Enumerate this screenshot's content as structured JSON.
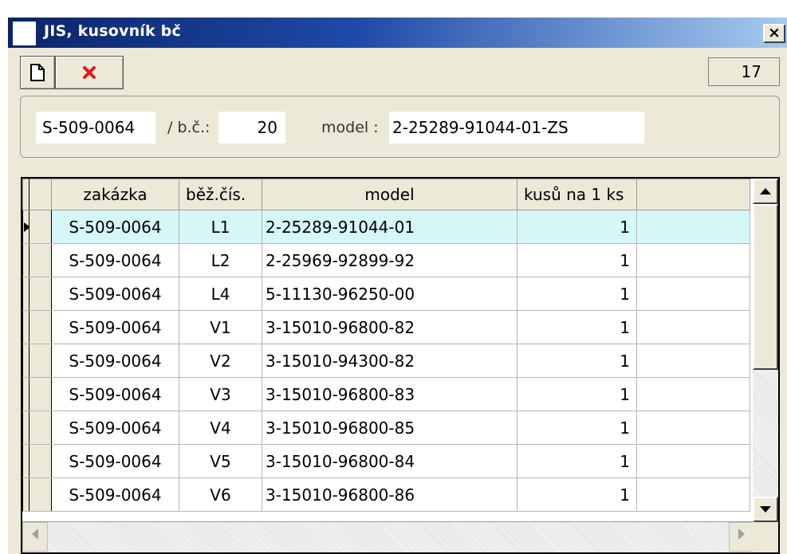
{
  "window": {
    "title": "JIS, kusovník bč",
    "close_label": "×"
  },
  "toolbar": {
    "new_icon": "new-document-icon",
    "delete_icon": "delete-x-icon",
    "delete_color": "#e01818",
    "count": "17"
  },
  "header": {
    "order": "S-509-0064",
    "bc_label": "/ b.č.:",
    "bc_value": "20",
    "model_label": "model :",
    "model_value": "2-25289-91044-01-ZS"
  },
  "grid": {
    "columns": [
      "zakázka",
      "běž.čís.",
      "model",
      "kusů na 1 ks",
      ""
    ],
    "rows": [
      {
        "zakazka": "S-509-0064",
        "bc": "L1",
        "model": "2-25289-91044-01",
        "kusu": "1",
        "selected": true
      },
      {
        "zakazka": "S-509-0064",
        "bc": "L2",
        "model": "2-25969-92899-92",
        "kusu": "1"
      },
      {
        "zakazka": "S-509-0064",
        "bc": "L4",
        "model": "5-11130-96250-00",
        "kusu": "1"
      },
      {
        "zakazka": "S-509-0064",
        "bc": "V1",
        "model": "3-15010-96800-82",
        "kusu": "1"
      },
      {
        "zakazka": "S-509-0064",
        "bc": "V2",
        "model": "3-15010-94300-82",
        "kusu": "1"
      },
      {
        "zakazka": "S-509-0064",
        "bc": "V3",
        "model": "3-15010-96800-83",
        "kusu": "1"
      },
      {
        "zakazka": "S-509-0064",
        "bc": "V4",
        "model": "3-15010-96800-85",
        "kusu": "1"
      },
      {
        "zakazka": "S-509-0064",
        "bc": "V5",
        "model": "3-15010-96800-84",
        "kusu": "1"
      },
      {
        "zakazka": "S-509-0064",
        "bc": "V6",
        "model": "3-15010-96800-86",
        "kusu": "1"
      }
    ],
    "selected_color": "#d6f7f7"
  }
}
